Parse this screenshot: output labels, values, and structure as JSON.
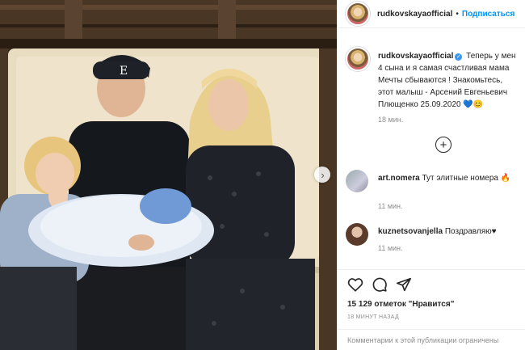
{
  "post": {
    "username": "rudkovskayaofficial",
    "follow_label": "Подписаться",
    "separator": "•"
  },
  "caption": {
    "username": "rudkovskayaofficial",
    "verified_mark": "✓",
    "line1": "Теперь у мен",
    "line2": "4 сына и я самая счастливая мама ",
    "line3": "Мечты сбываются ! Знакомьтесь,",
    "line4": "этот малыш - Арсений Евгеньевич",
    "line5": "Плющенко 25.09.2020 💙😊",
    "time": "18 мин."
  },
  "load_more_icon": "plus-circle-icon",
  "comments": [
    {
      "username": "art.nomera",
      "text": "Тут элитные номера 🔥",
      "time": "11 мин."
    },
    {
      "username": "kuznetsovanjella",
      "text": "Поздравляю♥",
      "time": "11 мин."
    }
  ],
  "actions": {
    "icons": [
      "heart-icon",
      "comment-icon",
      "share-icon"
    ],
    "likes": "15 129 отметок \"Нравится\"",
    "ago": "18 МИНУТ НАЗАД",
    "comments_disabled": "Комментарии к этой публикации ограничены"
  },
  "colors": {
    "accent": "#0095f6",
    "text": "#262626",
    "muted": "#8e8e8e",
    "border": "#efefef"
  }
}
